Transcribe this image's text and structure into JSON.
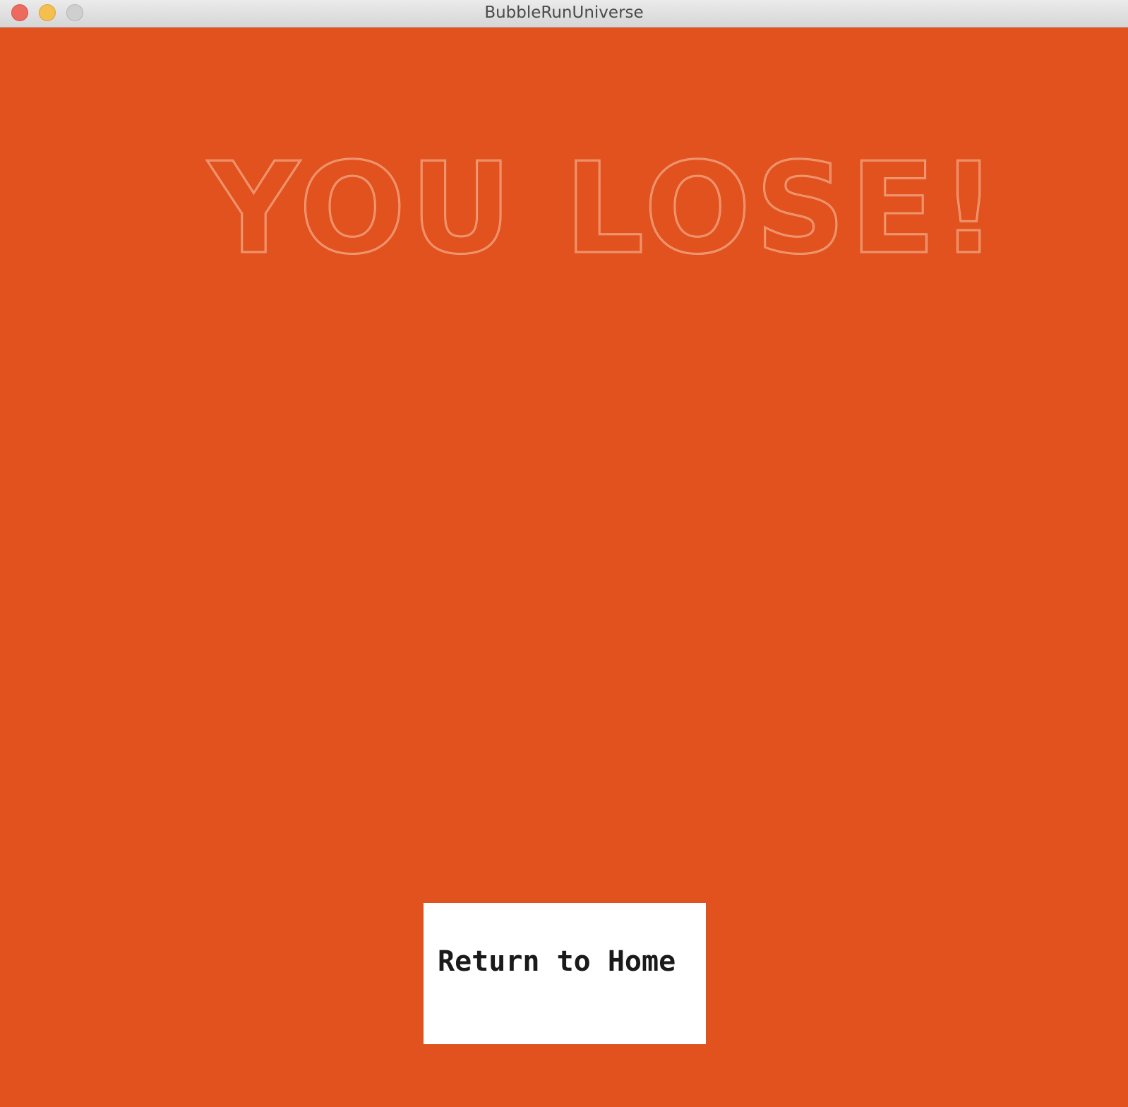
{
  "window": {
    "title": "BubbleRunUniverse",
    "controls": [
      "close",
      "minimize",
      "zoom"
    ]
  },
  "screen": {
    "headline": "YOU LOSE!",
    "background_color": "#e1521e",
    "headline_outline_color": "#f3a07d"
  },
  "actions": {
    "return_home_label": "Return to Home"
  }
}
